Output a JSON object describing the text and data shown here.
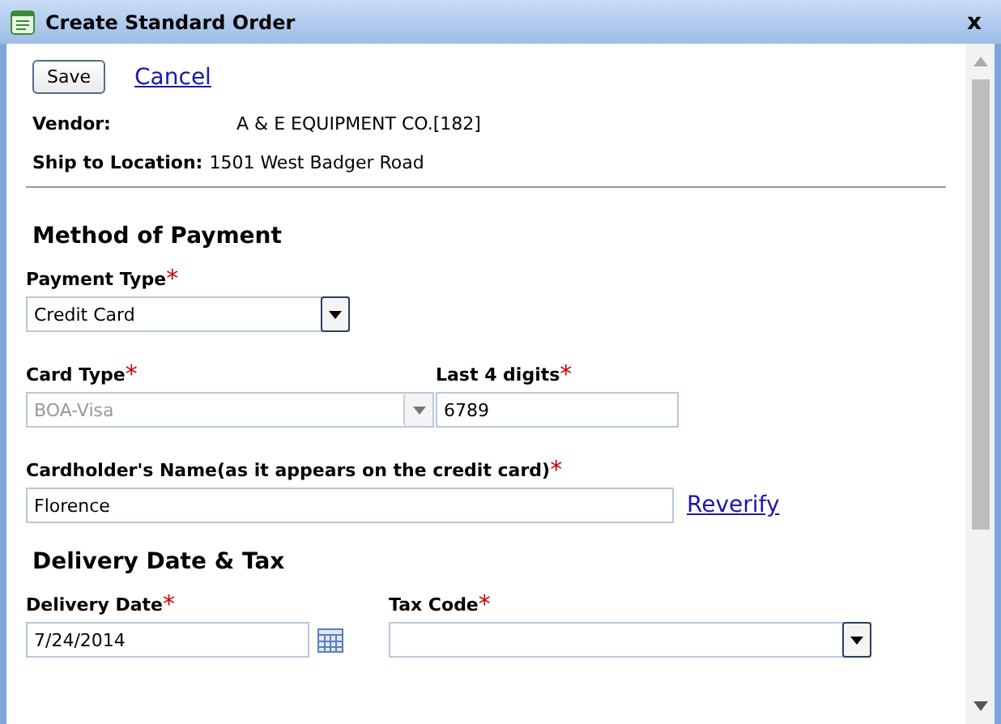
{
  "window": {
    "title": "Create Standard Order",
    "close": "x"
  },
  "actions": {
    "save": "Save",
    "cancel": "Cancel"
  },
  "info": [
    {
      "label": "Vendor:",
      "value": "A & E EQUIPMENT CO.[182]"
    },
    {
      "label": "Ship to Location:",
      "value": "1501 West Badger Road"
    }
  ],
  "payment": {
    "heading": "Method of Payment",
    "payment_type": {
      "label": "Payment Type",
      "required_mark": "*",
      "value": "Credit Card",
      "disabled": false
    },
    "card_type": {
      "label": "Card Type",
      "required_mark": "*",
      "value": "BOA-Visa",
      "disabled": true
    },
    "last_digits": {
      "label": "Last 4 digits",
      "required_mark": "*",
      "value": "6789"
    },
    "cardholder": {
      "label": "Cardholder's Name(as it appears on the credit card)",
      "required_mark": "*",
      "value": "Florence",
      "link": "Reverify"
    }
  },
  "delivery": {
    "heading": "Delivery Date & Tax",
    "date": {
      "label": "Delivery Date",
      "required_mark": "*",
      "value": "7/24/2014"
    },
    "tax_code": {
      "label": "Tax Code ",
      "required_mark": "*",
      "disabled": false
    }
  }
}
